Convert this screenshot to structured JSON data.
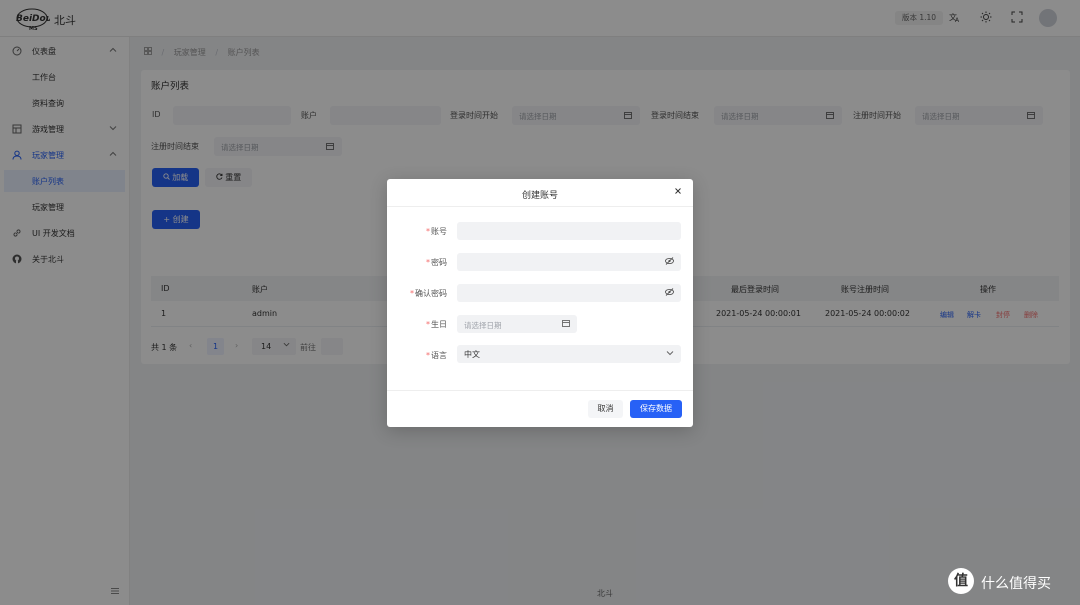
{
  "header": {
    "brand_logo_text": "BeiDou",
    "brand_logo_sub": "MS",
    "brand_name": "北斗",
    "version": "版本 1.10",
    "icons": [
      "translate-icon",
      "theme-icon",
      "fullscreen-icon"
    ]
  },
  "sidebar": {
    "items": [
      {
        "label": "仪表盘",
        "icon": "dashboard-icon"
      },
      {
        "label": "工作台"
      },
      {
        "label": "资料查询"
      },
      {
        "label": "游戏管理",
        "icon": "game-icon"
      },
      {
        "label": "玩家管理",
        "icon": "user-icon"
      },
      {
        "label": "账户列表"
      },
      {
        "label": "玩家管理"
      },
      {
        "label": "UI 开发文档",
        "icon": "link-icon"
      },
      {
        "label": "关于北斗",
        "icon": "github-icon"
      }
    ]
  },
  "breadcrumb": [
    "玩家管理",
    "账户列表"
  ],
  "panel": {
    "title": "账户列表",
    "filters": {
      "id_label": "ID",
      "account_label": "账户",
      "login_start_label": "登录时间开始",
      "login_start_placeholder": "请选择日期",
      "login_end_label": "登录时间结束",
      "login_end_placeholder": "请选择日期",
      "reg_start_label": "注册时间开始",
      "reg_start_placeholder": "请选择日期",
      "reg_end_label": "注册时间结束",
      "reg_end_placeholder": "请选择日期"
    },
    "buttons": {
      "load": "加载",
      "reset": "重置",
      "create": "创建"
    },
    "table": {
      "headers": {
        "id": "ID",
        "account": "账户",
        "last_login": "最后登录时间",
        "reg_time": "账号注册时间",
        "actions": "操作"
      },
      "rows": [
        {
          "id": "1",
          "account": "admin",
          "last_login": "2021-05-24 00:00:01",
          "reg_time": "2021-05-24 00:00:02",
          "actions": [
            "编辑",
            "解卡",
            "封停",
            "删除"
          ]
        }
      ]
    },
    "pagination": {
      "total": "共 1 条",
      "current_page": "1",
      "page_size": "14",
      "goto_label": "前往"
    }
  },
  "footer": {
    "text": "北斗"
  },
  "modal": {
    "title": "创建账号",
    "fields": {
      "account_label": "账号",
      "password_label": "密码",
      "confirm_label": "确认密码",
      "birthday_label": "生日",
      "birthday_placeholder": "请选择日期",
      "language_label": "语言",
      "language_value": "中文"
    },
    "buttons": {
      "cancel": "取消",
      "save": "保存数据"
    }
  },
  "watermark": {
    "badge": "值",
    "text": "什么值得买"
  },
  "colors": {
    "primary": "#2761f6",
    "danger": "#f56c6c",
    "overlay": "rgba(0,0,0,0.45)"
  }
}
